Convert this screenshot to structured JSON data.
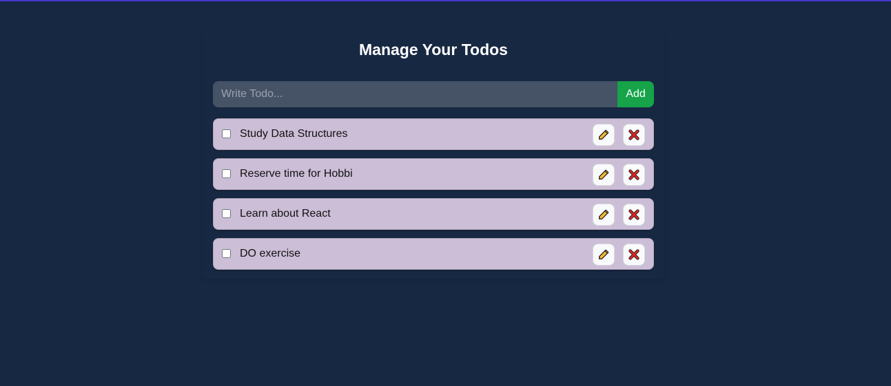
{
  "header": {
    "title": "Manage Your Todos"
  },
  "form": {
    "input_value": "",
    "placeholder": "Write Todo...",
    "add_label": "Add"
  },
  "todos": [
    {
      "text": "Study Data Structures",
      "completed": false
    },
    {
      "text": "Reserve time for Hobbi",
      "completed": false
    },
    {
      "text": "Learn about React",
      "completed": false
    },
    {
      "text": "DO exercise",
      "completed": false
    }
  ],
  "icons": {
    "edit": "pencil-icon",
    "delete": "cross-mark-icon"
  },
  "colors": {
    "background": "#172842",
    "accent_line": "#4338ca",
    "input_background": "#465367",
    "add_button": "#16a34a",
    "todo_background": "#ccbed7",
    "delete_icon": "#dc2626",
    "edit_icon": "#f5b731"
  }
}
